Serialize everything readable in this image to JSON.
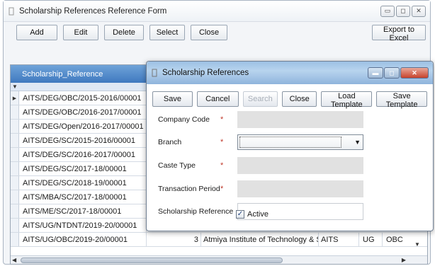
{
  "main_window": {
    "title": "Scholarship References Reference Form",
    "toolbar": [
      "Add",
      "Edit",
      "Delete",
      "Select",
      "Close"
    ],
    "export_label": "Export to Excel"
  },
  "grid": {
    "header": "Scholarship_Reference",
    "rows": [
      {
        "ref": "AITS/DEG/OBC/2015-2016/00001"
      },
      {
        "ref": "AITS/DEG/OBC/2016-2017/00001"
      },
      {
        "ref": "AITS/DEG/Open/2016-2017/00001"
      },
      {
        "ref": "AITS/DEG/SC/2015-2016/00001"
      },
      {
        "ref": "AITS/DEG/SC/2016-2017/00001"
      },
      {
        "ref": "AITS/DEG/SC/2017-18/00001"
      },
      {
        "ref": "AITS/DEG/SC/2018-19/00001"
      },
      {
        "ref": "AITS/MBA/SC/2017-18/00001"
      },
      {
        "ref": "AITS/ME/SC/2017-18/00001"
      },
      {
        "ref": "AITS/UG/NTDNT/2019-20/00001"
      },
      {
        "ref": "AITS/UG/OBC/2019-20/00001",
        "num": "3",
        "institute": "Atmiya Institute of Technology & Science",
        "code": "AITS",
        "level": "UG",
        "caste": "OBC"
      }
    ]
  },
  "dialog": {
    "title": "Scholarship References",
    "buttons": [
      "Save",
      "Cancel",
      "Search",
      "Close",
      "Load Template",
      "Save Template"
    ],
    "fields": {
      "company_code": "Company Code",
      "branch": "Branch",
      "caste_type": "Caste Type",
      "transaction_period": "Transaction Period",
      "scholarship_reference": "Scholarship Reference"
    },
    "required_mark": "*",
    "active_label": "Active",
    "active_checked": true
  }
}
